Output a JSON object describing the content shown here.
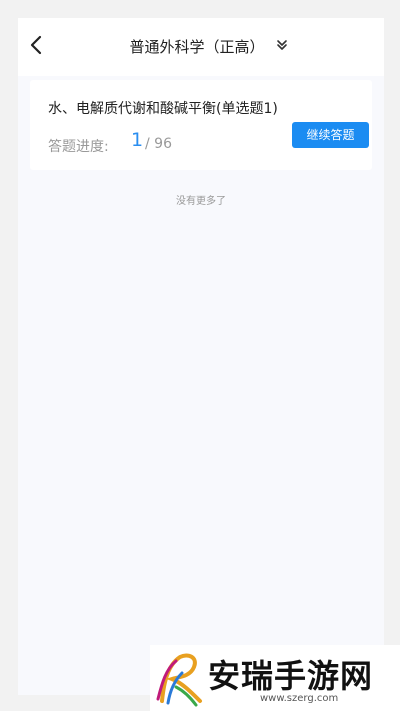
{
  "header": {
    "title": "普通外科学（正高）",
    "back_icon": "chevron-left-icon",
    "dropdown_icon": "double-chevron-down-icon"
  },
  "card": {
    "title": "水、电解质代谢和酸碱平衡(单选题1)",
    "progress_label": "答题进度:",
    "progress_current": "1",
    "progress_total": "/ 96",
    "progress_fraction": 0.0104,
    "button_label": "继续答题"
  },
  "footer_text": "没有更多了",
  "watermark": {
    "name": "安瑞手游网",
    "url": "www.szerg.com"
  },
  "colors": {
    "accent": "#1b8cf2",
    "progress_number": "#2a8ef0",
    "page_bg": "#f8f9fd",
    "muted_text": "#999999"
  }
}
